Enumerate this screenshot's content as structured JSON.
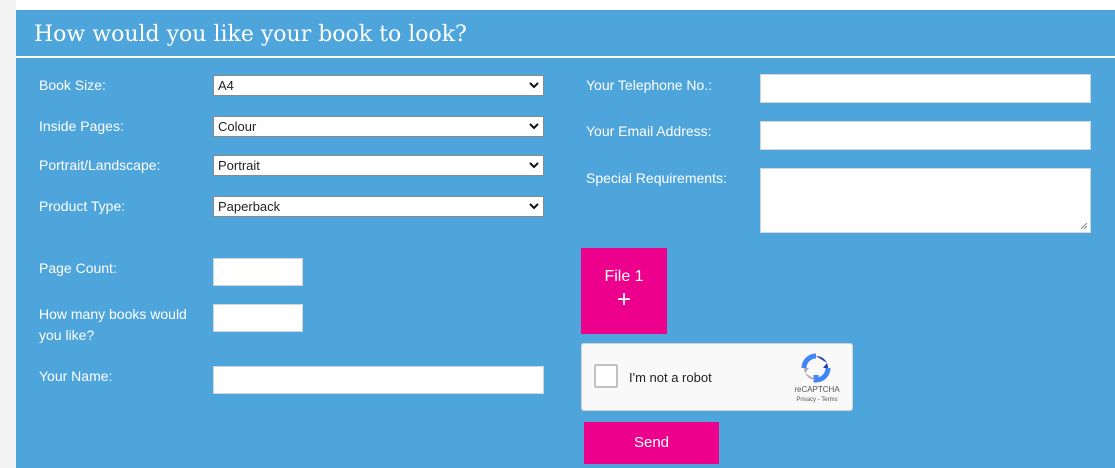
{
  "form": {
    "title": "How would you like your book to look?",
    "book_size": {
      "label": "Book Size:",
      "value": "A4"
    },
    "inside_pages": {
      "label": "Inside Pages:",
      "value": "Colour"
    },
    "orientation": {
      "label": "Portrait/Landscape:",
      "value": "Portrait"
    },
    "product_type": {
      "label": "Product Type:",
      "value": "Paperback"
    },
    "page_count": {
      "label": "Page Count:",
      "value": ""
    },
    "quantity": {
      "label_line1": "How many books would",
      "label_line2": "you like?",
      "value": ""
    },
    "name": {
      "label": "Your Name:",
      "value": ""
    },
    "telephone": {
      "label": "Your Telephone No.:",
      "value": ""
    },
    "email": {
      "label": "Your Email Address:",
      "value": ""
    },
    "special": {
      "label": "Special Requirements:",
      "value": ""
    },
    "file_button": {
      "label": "File 1",
      "icon": "+"
    },
    "captcha": {
      "label": "I'm not a robot",
      "brand": "reCAPTCHA",
      "links": "Privacy - Terms"
    },
    "send_label": "Send"
  },
  "colors": {
    "panel": "#4ea5dc",
    "accent": "#ec008c"
  }
}
